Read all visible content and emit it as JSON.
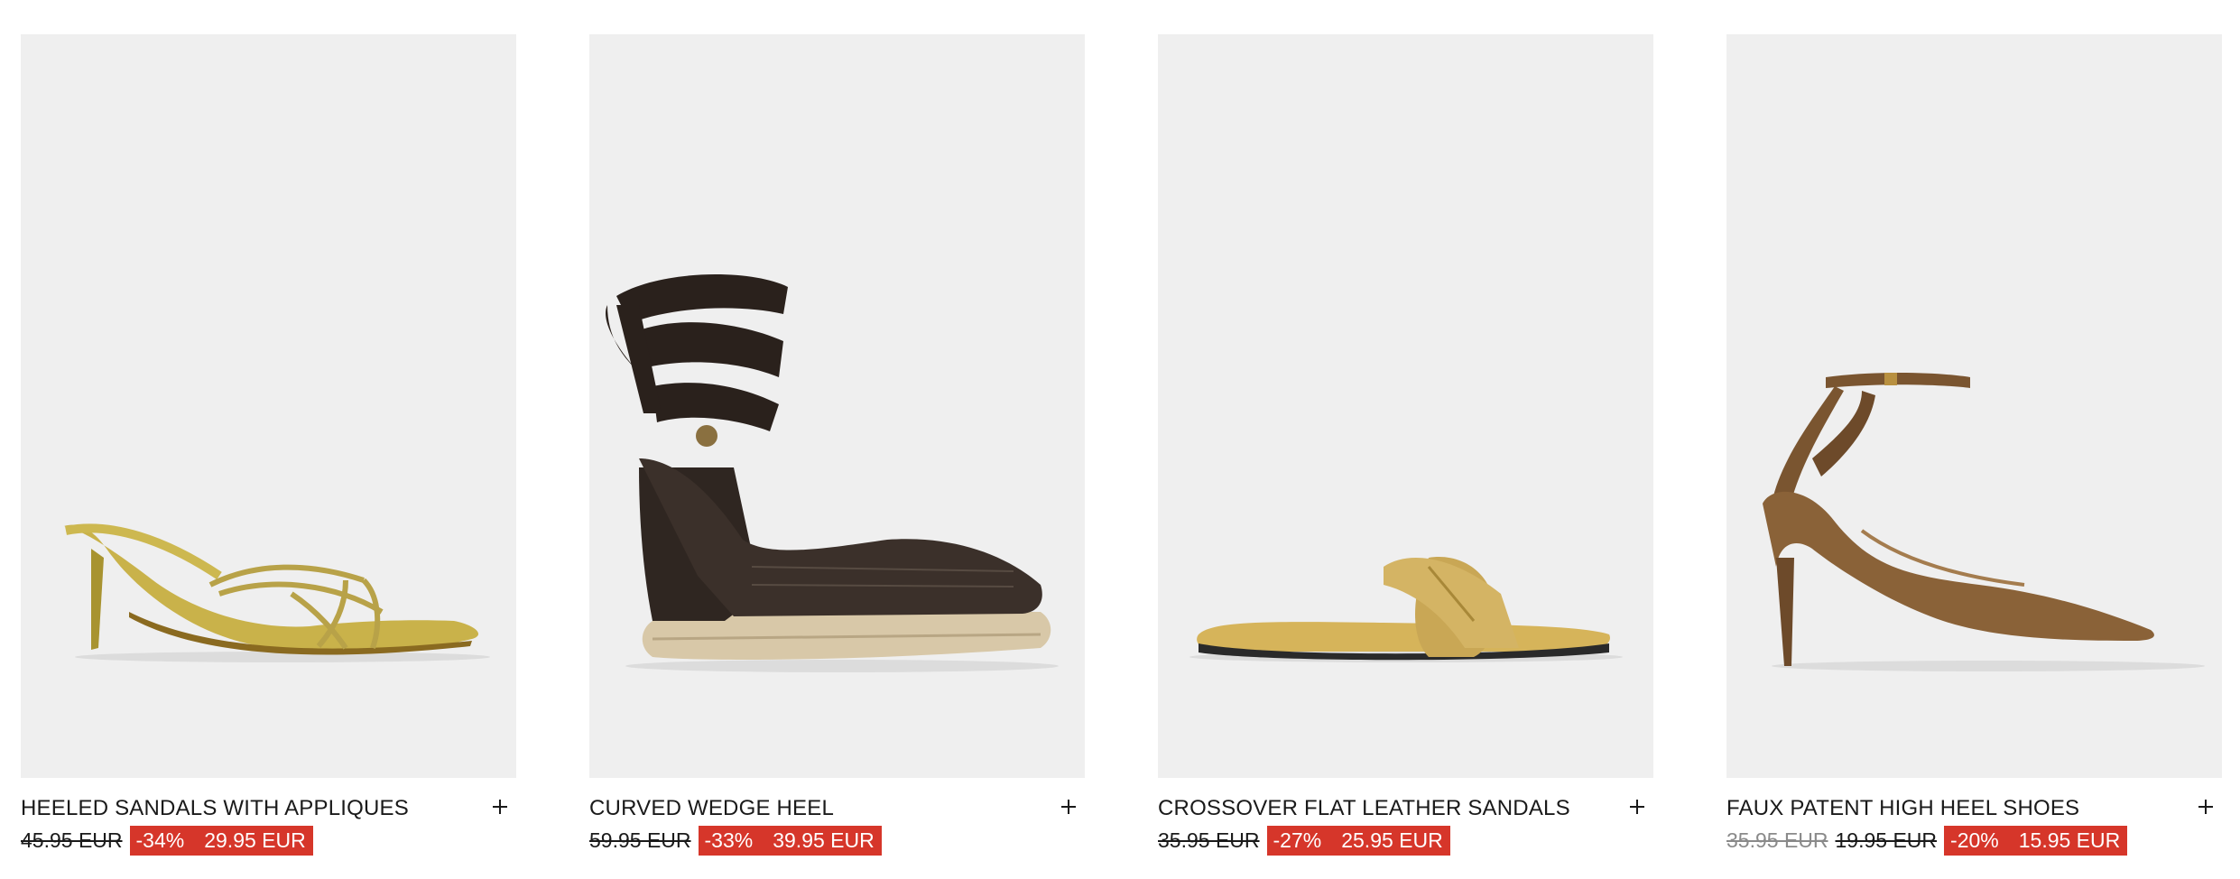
{
  "products": [
    {
      "title": "HEELED SANDALS WITH APPLIQUES",
      "old_price": "45.95 EUR",
      "discount": "-34%",
      "price": "29.95 EUR"
    },
    {
      "title": "CURVED WEDGE HEEL",
      "old_price": "59.95 EUR",
      "discount": "-33%",
      "price": "39.95 EUR"
    },
    {
      "title": "CROSSOVER FLAT LEATHER SANDALS",
      "old_price": "35.95 EUR",
      "discount": "-27%",
      "price": "25.95 EUR"
    },
    {
      "title": "FAUX PATENT HIGH HEEL SHOES",
      "original_price": "35.95 EUR",
      "old_price": "19.95 EUR",
      "discount": "-20%",
      "price": "15.95 EUR"
    }
  ],
  "colors": {
    "sale": "#d6362a",
    "image_bg": "#efefef",
    "text": "#1a1a1a"
  }
}
